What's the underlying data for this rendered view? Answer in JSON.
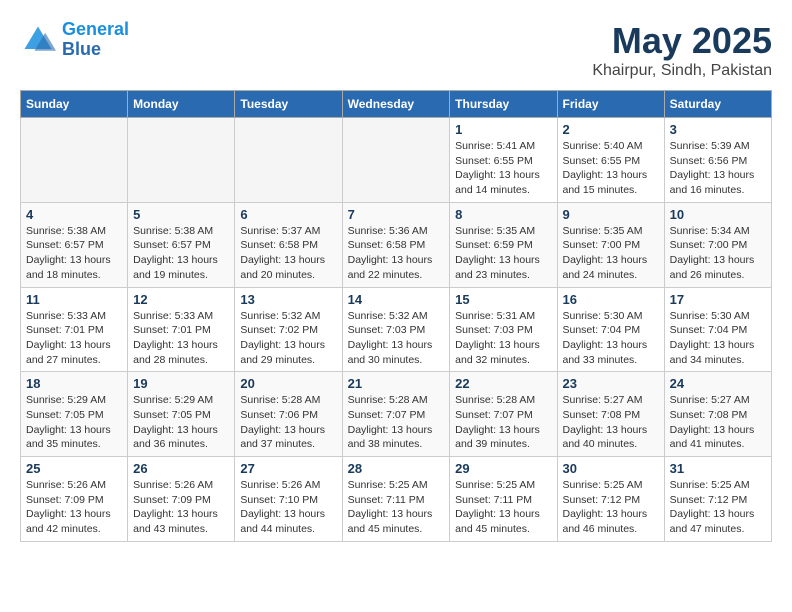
{
  "header": {
    "logo_line1": "General",
    "logo_line2": "Blue",
    "month": "May 2025",
    "location": "Khairpur, Sindh, Pakistan"
  },
  "weekdays": [
    "Sunday",
    "Monday",
    "Tuesday",
    "Wednesday",
    "Thursday",
    "Friday",
    "Saturday"
  ],
  "weeks": [
    [
      {
        "day": "",
        "info": ""
      },
      {
        "day": "",
        "info": ""
      },
      {
        "day": "",
        "info": ""
      },
      {
        "day": "",
        "info": ""
      },
      {
        "day": "1",
        "info": "Sunrise: 5:41 AM\nSunset: 6:55 PM\nDaylight: 13 hours\nand 14 minutes."
      },
      {
        "day": "2",
        "info": "Sunrise: 5:40 AM\nSunset: 6:55 PM\nDaylight: 13 hours\nand 15 minutes."
      },
      {
        "day": "3",
        "info": "Sunrise: 5:39 AM\nSunset: 6:56 PM\nDaylight: 13 hours\nand 16 minutes."
      }
    ],
    [
      {
        "day": "4",
        "info": "Sunrise: 5:38 AM\nSunset: 6:57 PM\nDaylight: 13 hours\nand 18 minutes."
      },
      {
        "day": "5",
        "info": "Sunrise: 5:38 AM\nSunset: 6:57 PM\nDaylight: 13 hours\nand 19 minutes."
      },
      {
        "day": "6",
        "info": "Sunrise: 5:37 AM\nSunset: 6:58 PM\nDaylight: 13 hours\nand 20 minutes."
      },
      {
        "day": "7",
        "info": "Sunrise: 5:36 AM\nSunset: 6:58 PM\nDaylight: 13 hours\nand 22 minutes."
      },
      {
        "day": "8",
        "info": "Sunrise: 5:35 AM\nSunset: 6:59 PM\nDaylight: 13 hours\nand 23 minutes."
      },
      {
        "day": "9",
        "info": "Sunrise: 5:35 AM\nSunset: 7:00 PM\nDaylight: 13 hours\nand 24 minutes."
      },
      {
        "day": "10",
        "info": "Sunrise: 5:34 AM\nSunset: 7:00 PM\nDaylight: 13 hours\nand 26 minutes."
      }
    ],
    [
      {
        "day": "11",
        "info": "Sunrise: 5:33 AM\nSunset: 7:01 PM\nDaylight: 13 hours\nand 27 minutes."
      },
      {
        "day": "12",
        "info": "Sunrise: 5:33 AM\nSunset: 7:01 PM\nDaylight: 13 hours\nand 28 minutes."
      },
      {
        "day": "13",
        "info": "Sunrise: 5:32 AM\nSunset: 7:02 PM\nDaylight: 13 hours\nand 29 minutes."
      },
      {
        "day": "14",
        "info": "Sunrise: 5:32 AM\nSunset: 7:03 PM\nDaylight: 13 hours\nand 30 minutes."
      },
      {
        "day": "15",
        "info": "Sunrise: 5:31 AM\nSunset: 7:03 PM\nDaylight: 13 hours\nand 32 minutes."
      },
      {
        "day": "16",
        "info": "Sunrise: 5:30 AM\nSunset: 7:04 PM\nDaylight: 13 hours\nand 33 minutes."
      },
      {
        "day": "17",
        "info": "Sunrise: 5:30 AM\nSunset: 7:04 PM\nDaylight: 13 hours\nand 34 minutes."
      }
    ],
    [
      {
        "day": "18",
        "info": "Sunrise: 5:29 AM\nSunset: 7:05 PM\nDaylight: 13 hours\nand 35 minutes."
      },
      {
        "day": "19",
        "info": "Sunrise: 5:29 AM\nSunset: 7:05 PM\nDaylight: 13 hours\nand 36 minutes."
      },
      {
        "day": "20",
        "info": "Sunrise: 5:28 AM\nSunset: 7:06 PM\nDaylight: 13 hours\nand 37 minutes."
      },
      {
        "day": "21",
        "info": "Sunrise: 5:28 AM\nSunset: 7:07 PM\nDaylight: 13 hours\nand 38 minutes."
      },
      {
        "day": "22",
        "info": "Sunrise: 5:28 AM\nSunset: 7:07 PM\nDaylight: 13 hours\nand 39 minutes."
      },
      {
        "day": "23",
        "info": "Sunrise: 5:27 AM\nSunset: 7:08 PM\nDaylight: 13 hours\nand 40 minutes."
      },
      {
        "day": "24",
        "info": "Sunrise: 5:27 AM\nSunset: 7:08 PM\nDaylight: 13 hours\nand 41 minutes."
      }
    ],
    [
      {
        "day": "25",
        "info": "Sunrise: 5:26 AM\nSunset: 7:09 PM\nDaylight: 13 hours\nand 42 minutes."
      },
      {
        "day": "26",
        "info": "Sunrise: 5:26 AM\nSunset: 7:09 PM\nDaylight: 13 hours\nand 43 minutes."
      },
      {
        "day": "27",
        "info": "Sunrise: 5:26 AM\nSunset: 7:10 PM\nDaylight: 13 hours\nand 44 minutes."
      },
      {
        "day": "28",
        "info": "Sunrise: 5:25 AM\nSunset: 7:11 PM\nDaylight: 13 hours\nand 45 minutes."
      },
      {
        "day": "29",
        "info": "Sunrise: 5:25 AM\nSunset: 7:11 PM\nDaylight: 13 hours\nand 45 minutes."
      },
      {
        "day": "30",
        "info": "Sunrise: 5:25 AM\nSunset: 7:12 PM\nDaylight: 13 hours\nand 46 minutes."
      },
      {
        "day": "31",
        "info": "Sunrise: 5:25 AM\nSunset: 7:12 PM\nDaylight: 13 hours\nand 47 minutes."
      }
    ]
  ]
}
